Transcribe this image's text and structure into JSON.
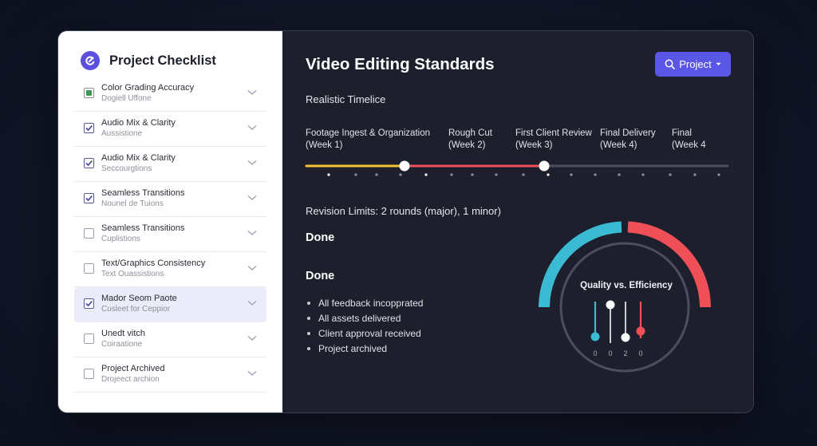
{
  "sidebar": {
    "title": "Project Checklist",
    "items": [
      {
        "title": "Color Grading Accuracy",
        "subtitle": "Dogiell Uffone",
        "state": "dot"
      },
      {
        "title": "Audio Mix & Clarity",
        "subtitle": "Aussistione",
        "state": "checked"
      },
      {
        "title": "Audio Mix & Clarity",
        "subtitle": "Seccourgtions",
        "state": "checked"
      },
      {
        "title": "Seamless Transitions",
        "subtitle": "Nounel de Tuions",
        "state": "checked"
      },
      {
        "title": "Seamless Transitions",
        "subtitle": "Cuplistions",
        "state": "unchecked"
      },
      {
        "title": "Text/Graphics Consistency",
        "subtitle": "Text Ouassistions",
        "state": "unchecked"
      },
      {
        "title": "Mador Seom Paote",
        "subtitle": "Cusleet for Ceppior",
        "state": "checked"
      },
      {
        "title": "Unedt vitch",
        "subtitle": "Coiraatione",
        "state": "unchecked"
      },
      {
        "title": "Project Archived",
        "subtitle": "Drojeect archion",
        "state": "unchecked"
      }
    ]
  },
  "main": {
    "title": "Video Editing Standards",
    "project_button": "Project",
    "timeline_label": "Realistic Timelice",
    "stages": [
      {
        "name": "Footage Ingest & Organization",
        "week": "(Week 1)"
      },
      {
        "name": "Rough Cut",
        "week": "(Week 2)"
      },
      {
        "name": "First Client Review",
        "week": "(Week 3)"
      },
      {
        "name": "Final Delivery",
        "week": "(Week 4)"
      },
      {
        "name": "Final",
        "week": "(Week 4"
      }
    ],
    "revision_limits": "Revision Limits: 2 rounds (major), 1 minor)",
    "done_1": "Done",
    "done_2": "Done",
    "bullets": [
      "All feedback incopprated",
      "All assets delivered",
      "Client approval received",
      "Project archived"
    ],
    "gauge": {
      "title": "Quality vs. Efficiency",
      "slider_labels": [
        "0",
        "0",
        "2",
        "0"
      ],
      "colors": {
        "teal": "#3bbad3",
        "red": "#ef4f57"
      }
    }
  },
  "colors": {
    "accent": "#5a57e6",
    "timeline_yellow": "#f2c12e",
    "timeline_red": "#ef4f57"
  }
}
